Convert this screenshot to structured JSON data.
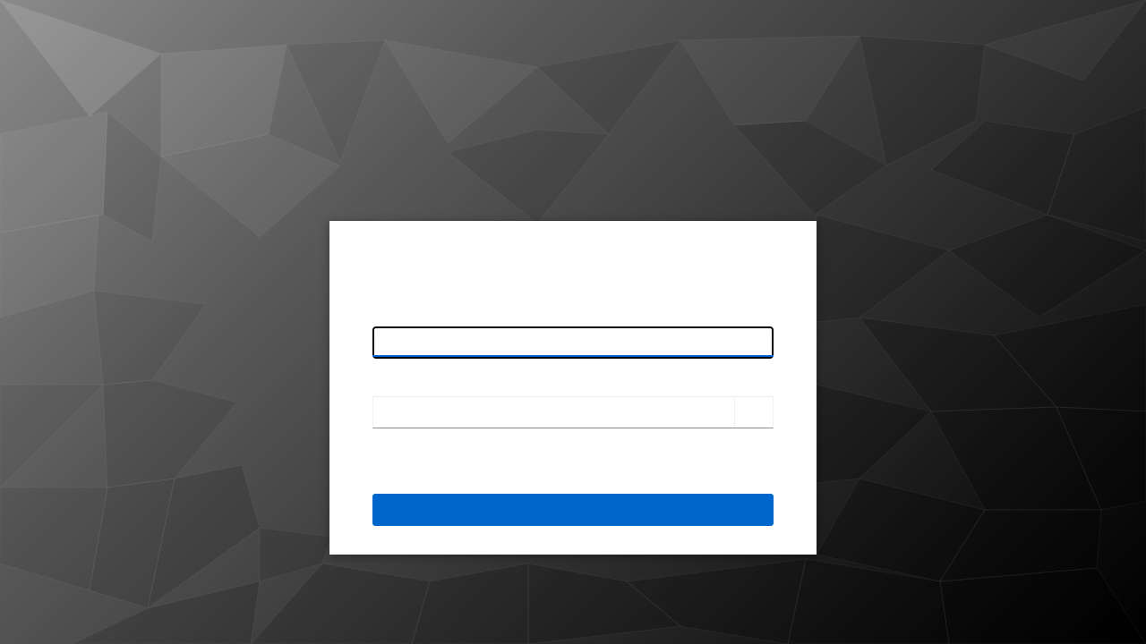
{
  "colors": {
    "accent": "#0066cc",
    "card_background": "#ffffff",
    "background_light": "#8a8a8a",
    "background_dark": "#000000"
  },
  "login": {
    "username": {
      "value": "",
      "placeholder": ""
    },
    "password": {
      "value": "",
      "placeholder": ""
    },
    "toggle_visibility_icon": "eye-icon",
    "submit_label": ""
  }
}
